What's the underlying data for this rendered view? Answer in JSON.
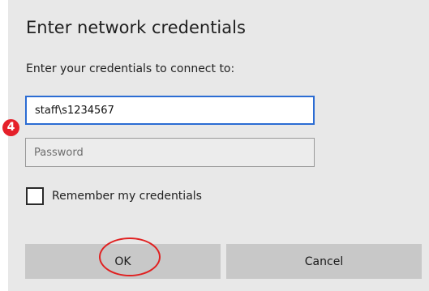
{
  "dialog": {
    "title": "Enter network credentials",
    "subtitle": "Enter your credentials to connect to:",
    "username_value": "staff\\s1234567",
    "password_placeholder": "Password",
    "remember_label": "Remember my credentials",
    "remember_checked": false,
    "step_badge": "4",
    "ok_label": "OK",
    "cancel_label": "Cancel"
  },
  "colors": {
    "dialog_background": "#e8e8e8",
    "focus_border": "#2b6cd3",
    "button_background": "#c8c8c8",
    "badge_red": "#e5202a",
    "highlight_red": "#e02020"
  }
}
